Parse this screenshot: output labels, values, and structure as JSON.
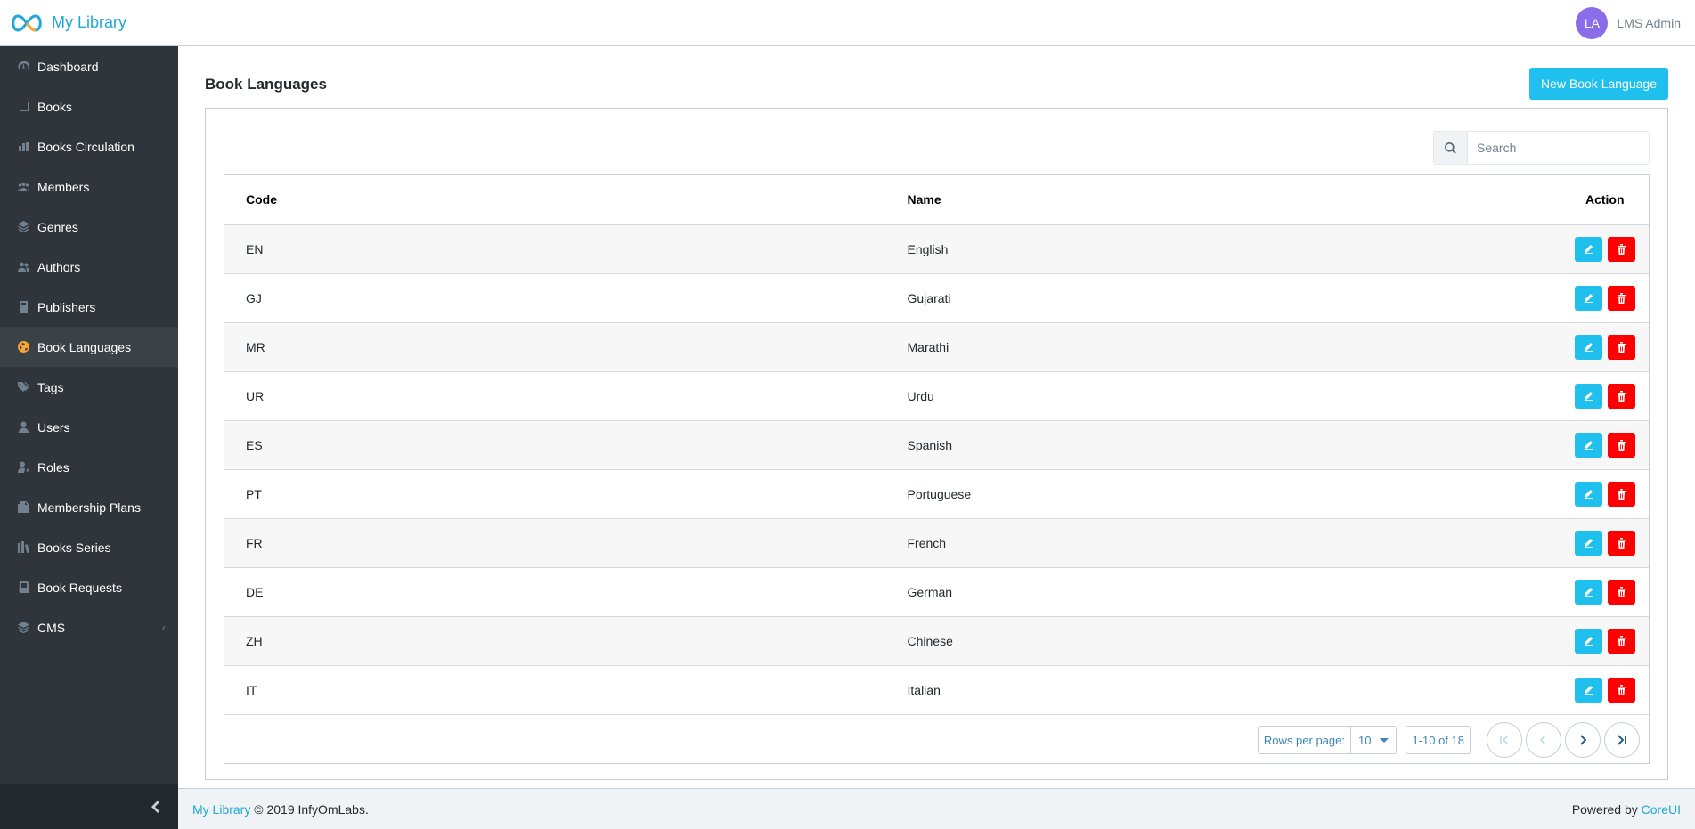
{
  "app": {
    "brand": "My Library",
    "user_initials": "LA",
    "user_name": "LMS Admin"
  },
  "sidebar": {
    "items": [
      {
        "label": "Dashboard",
        "icon": "dashboard-icon",
        "active": false
      },
      {
        "label": "Books",
        "icon": "book-icon",
        "active": false
      },
      {
        "label": "Books Circulation",
        "icon": "circulation-icon",
        "active": false
      },
      {
        "label": "Members",
        "icon": "members-icon",
        "active": false
      },
      {
        "label": "Genres",
        "icon": "layers-icon",
        "active": false
      },
      {
        "label": "Authors",
        "icon": "authors-icon",
        "active": false
      },
      {
        "label": "Publishers",
        "icon": "publisher-icon",
        "active": false
      },
      {
        "label": "Book Languages",
        "icon": "globe-icon",
        "active": true
      },
      {
        "label": "Tags",
        "icon": "tags-icon",
        "active": false
      },
      {
        "label": "Users",
        "icon": "user-icon",
        "active": false
      },
      {
        "label": "Roles",
        "icon": "roles-icon",
        "active": false
      },
      {
        "label": "Membership Plans",
        "icon": "plans-icon",
        "active": false
      },
      {
        "label": "Books Series",
        "icon": "series-icon",
        "active": false
      },
      {
        "label": "Book Requests",
        "icon": "request-icon",
        "active": false
      },
      {
        "label": "CMS",
        "icon": "layers-icon",
        "active": false,
        "has_children": true
      }
    ]
  },
  "page": {
    "title": "Book Languages",
    "new_button": "New Book Language",
    "search_placeholder": "Search"
  },
  "table": {
    "headers": {
      "code": "Code",
      "name": "Name",
      "action": "Action"
    },
    "rows": [
      {
        "code": "EN",
        "name": "English"
      },
      {
        "code": "GJ",
        "name": "Gujarati"
      },
      {
        "code": "MR",
        "name": "Marathi"
      },
      {
        "code": "UR",
        "name": "Urdu"
      },
      {
        "code": "ES",
        "name": "Spanish"
      },
      {
        "code": "PT",
        "name": "Portuguese"
      },
      {
        "code": "FR",
        "name": "French"
      },
      {
        "code": "DE",
        "name": "German"
      },
      {
        "code": "ZH",
        "name": "Chinese"
      },
      {
        "code": "IT",
        "name": "Italian"
      }
    ]
  },
  "pagination": {
    "rows_per_page_label": "Rows per page:",
    "rows_per_page_value": "10",
    "range": "1-10 of 18"
  },
  "footer": {
    "brand_link": "My Library",
    "copyright": "© 2019 InfyOmLabs.",
    "powered_by": "Powered by",
    "powered_link": "CoreUI"
  },
  "colors": {
    "accent": "#20a8d8",
    "primary_button": "#20c0ee",
    "danger": "#ff0000",
    "sidebar_bg": "#2f353a",
    "active_icon": "#f8a532"
  }
}
